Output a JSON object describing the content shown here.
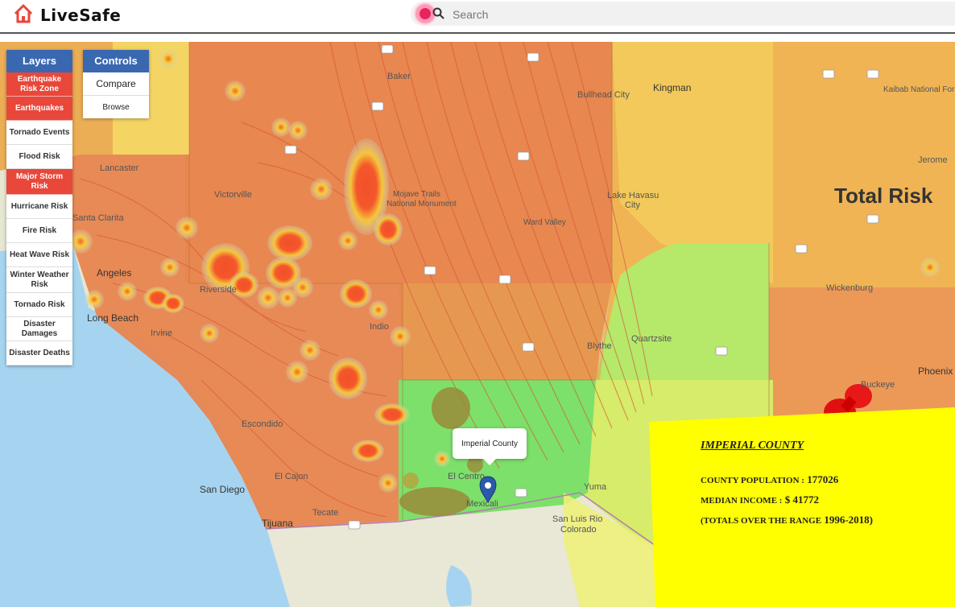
{
  "app": {
    "name": "LiveSafe",
    "logo_icon": "home-icon"
  },
  "search": {
    "placeholder": "Search"
  },
  "layers_panel": {
    "title": "Layers",
    "items": [
      {
        "label": "Earthquake Risk Zone",
        "active": true
      },
      {
        "label": "Earthquakes",
        "active": true
      },
      {
        "label": "Tornado Events",
        "active": false
      },
      {
        "label": "Flood Risk",
        "active": false
      },
      {
        "label": "Major Storm Risk",
        "active": true
      },
      {
        "label": "Hurricane Risk",
        "active": false
      },
      {
        "label": "Fire Risk",
        "active": false
      },
      {
        "label": "Heat Wave Risk",
        "active": false
      },
      {
        "label": "Winter Weather Risk",
        "active": false
      },
      {
        "label": "Tornado Risk",
        "active": false
      },
      {
        "label": "Disaster Damages",
        "active": false
      },
      {
        "label": "Disaster Deaths",
        "active": false
      }
    ]
  },
  "controls_panel": {
    "title": "Controls",
    "items": [
      {
        "label": "Compare"
      },
      {
        "label": "Browse"
      }
    ]
  },
  "map": {
    "overlay_title": "Total Risk",
    "tooltip": "Imperial County",
    "place_labels": [
      "Baker",
      "Kingman",
      "Bullhead City",
      "Kaibab National Fore",
      "Lancaster",
      "Victorville",
      "Mojave Trails",
      "National Monument",
      "Lake Havasu",
      "City",
      "Ward Valley",
      "Jerome",
      "Angeles",
      "Riverside",
      "Long Beach",
      "Irvine",
      "Indio",
      "Quartzsite",
      "Blythe",
      "Wickenburg",
      "Phoenix",
      "Buckeye",
      "Escondido",
      "El Cajon",
      "San Diego",
      "Tijuana",
      "Tecate",
      "El Centro",
      "Mexicali",
      "San Luis Rio",
      "Colorado",
      "Yuma",
      "Santa Clarita"
    ],
    "colors": {
      "high": "#e8854f",
      "moderate": "#f0b455",
      "low": "#f3d460",
      "very_low": "#a8e86a",
      "lowest": "#7de06a",
      "ocean": "#a6d4f0",
      "land": "#e6e7d2",
      "storm_core": "#f4502a",
      "info_card": "#ffff00",
      "pin": "#e01010",
      "marker": "#2a5aa8"
    }
  },
  "county_info": {
    "title": "IMPERIAL COUNTY",
    "population_label": "COUNTY POPULATION :",
    "population_value": "177026",
    "income_label": "MEDIAN INCOME :",
    "income_value": "$ 41772",
    "range_label": "(TOTALS OVER THE RANGE",
    "range_value": "1996-2018)"
  }
}
